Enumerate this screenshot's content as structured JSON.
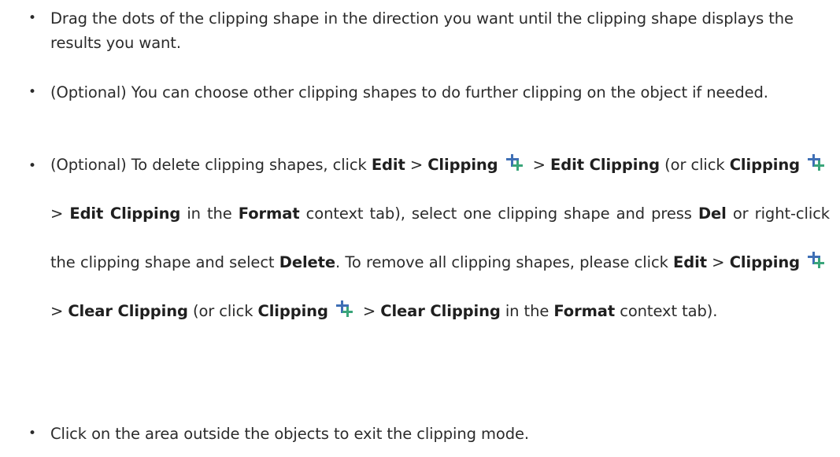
{
  "bullet_char": "•",
  "items": [
    {
      "text": "Drag the dots of the clipping shape in the direction you want until the clipping shape displays the results you want."
    },
    {
      "text": "(Optional) You can choose other clipping shapes to do further clipping on the object if needed."
    },
    {
      "segments": {
        "s1": "(Optional) To delete clipping shapes, click ",
        "edit1": "Edit",
        "gt1": " > ",
        "clipping1": "Clipping",
        "gt2": " > ",
        "edit_clipping1": "Edit Clipping",
        "s2": " (or click ",
        "clipping2": "Clipping",
        "gt3": " > ",
        "edit_clipping2": "Edit Clipping",
        "s3": " in the ",
        "format1": "Format",
        "s4": " context tab), select one clipping shape and press ",
        "del": "Del",
        "s5": " or right-click the clipping shape and select ",
        "delete": "Delete",
        "s6": ". To remove all clipping shapes, please click ",
        "edit2": "Edit",
        "gt4": " > ",
        "clipping3": "Clipping",
        "gt5": " > ",
        "clear_clipping1": "Clear Clipping",
        "s7": " (or click ",
        "clipping4": "Clipping",
        "gt6": " > ",
        "clear_clipping2": "Clear Clipping",
        "s8": " in the ",
        "format2": "Format",
        "s9": " context tab)."
      }
    },
    {
      "text": "Click on the area outside the objects to exit the clipping mode."
    }
  ],
  "icons": {
    "clipping": "clipping-icon"
  },
  "colors": {
    "text": "#2b2b2b",
    "icon_blue": "#3f6fb5",
    "icon_green": "#3aa57a"
  }
}
